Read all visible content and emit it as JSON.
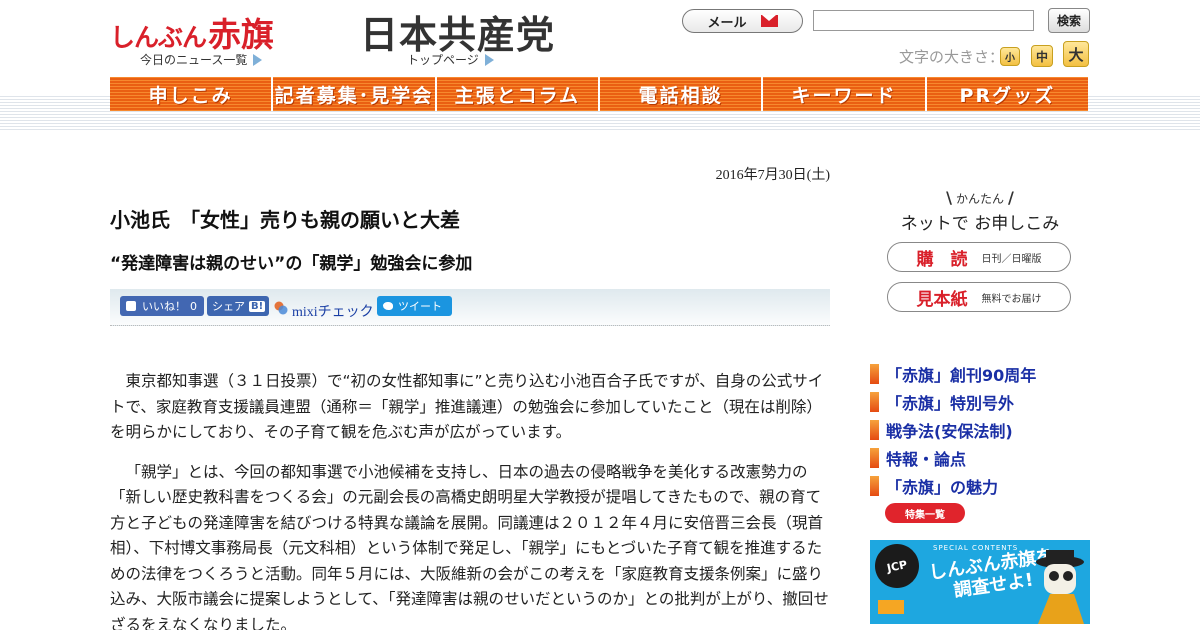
{
  "header": {
    "akahata_logo_kana": "しんぶん",
    "akahata_logo_kanji": "赤旗",
    "akahata_sublink": "今日のニュース一覧",
    "jcp_logo": "日本共産党",
    "jcp_sublink": "トップページ",
    "mail_label": "メール",
    "search_value": "",
    "search_button": "検索",
    "fontsize_label": "文字の大きさ：",
    "fontsize_options": [
      "小",
      "中",
      "大"
    ]
  },
  "nav": {
    "items": [
      "申しこみ",
      "記者募集･見学会",
      "主張とコラム",
      "電話相談",
      "キーワード",
      "PRグッズ"
    ]
  },
  "article": {
    "date": "2016年7月30日(土)",
    "title": "小池氏　「女性」売りも親の願いと大差",
    "subtitle": "“発達障害は親のせい”の「親学」勉強会に参加",
    "share": {
      "like_label": "いいね！",
      "like_count": "0",
      "share_label": "シェア",
      "hatena_label": "B!",
      "mixi_label": "mixiチェック",
      "tweet_label": "ツイート"
    },
    "paragraphs": [
      "東京都知事選（３１日投票）で“初の女性都知事に”と売り込む小池百合子氏ですが、自身の公式サイトで、家庭教育支援議員連盟（通称＝「親学」推進議連）の勉強会に参加していたこと（現在は削除）を明らかにしており、その子育て観を危ぶむ声が広がっています。",
      "「親学」とは、今回の都知事選で小池候補を支持し、日本の過去の侵略戦争を美化する改憲勢力の「新しい歴史教科書をつくる会」の元副会長の高橋史朗明星大学教授が提唱してきたもので、親の育て方と子どもの発達障害を結びつける特異な議論を展開。同議連は２０１２年４月に安倍晋三会長（現首相）、下村博文事務局長（元文科相）という体制で発足し、「親学」にもとづいた子育て観を推進するための法律をつくろうと活動。同年５月には、大阪維新の会がこの考えを「家庭教育支援条例案」に盛り込み、大阪市議会に提案しようとして、「発達障害は親のせいだというのか」との批判が上がり、撤回せざるをえなくなりました。"
    ]
  },
  "sidebar": {
    "kantan_small": "かんたん",
    "kantan_main": "ネットで お申しこみ",
    "subscribe_main": "購　読",
    "subscribe_note": "日刊／日曜版",
    "sample_main": "見本紙",
    "sample_note": "無料でお届け",
    "links": [
      "「赤旗」創刊90周年",
      "「赤旗」特別号外",
      "戦争法(安保法制)",
      "特報・論点",
      "「赤旗」の魅力"
    ],
    "tokushu_button": "特集一覧",
    "banner": {
      "badge": "JCP",
      "special": "SPECIAL CONTENTS",
      "catch_line1": "しんぶん赤旗を",
      "catch_line2": "調査せよ!"
    }
  },
  "colors": {
    "brand_red": "#d9202a",
    "nav_orange": "#f06a18",
    "link_blue": "#1a2fa5",
    "banner_blue": "#1ea7e0"
  }
}
